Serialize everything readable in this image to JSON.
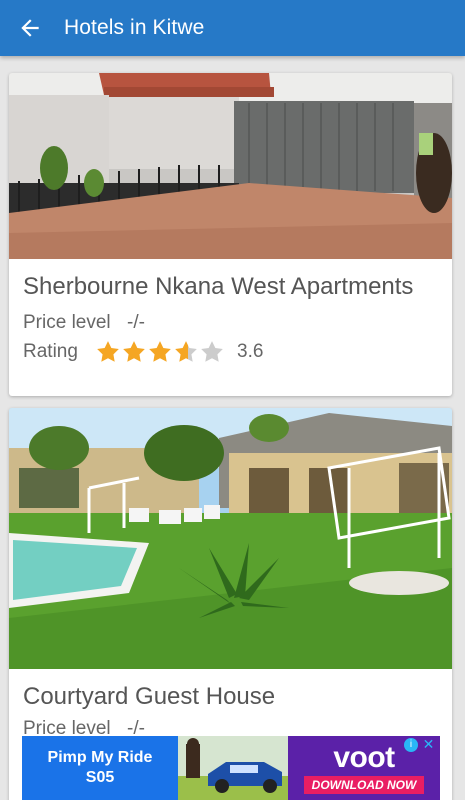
{
  "app_bar": {
    "title": "Hotels in Kitwe",
    "back_icon": "arrow-back-icon"
  },
  "hotels": [
    {
      "name": "Sherbourne Nkana West Apartments",
      "price_label": "Price level",
      "price_value": "-/-",
      "rating_label": "Rating",
      "rating_value": "3.6",
      "rating": 3.6
    },
    {
      "name": "Courtyard Guest House",
      "price_label": "Price level",
      "price_value": "-/-"
    }
  ],
  "ad": {
    "line1": "Pimp My Ride",
    "line2": "S05",
    "brand": "voot",
    "cta": "DOWNLOAD NOW",
    "info_icon": "info-icon",
    "close_icon": "close-icon"
  },
  "colors": {
    "app_bar": "#2679c7",
    "star_filled": "#f5a623",
    "star_empty": "#cccccc",
    "background": "#e6e6e6"
  }
}
